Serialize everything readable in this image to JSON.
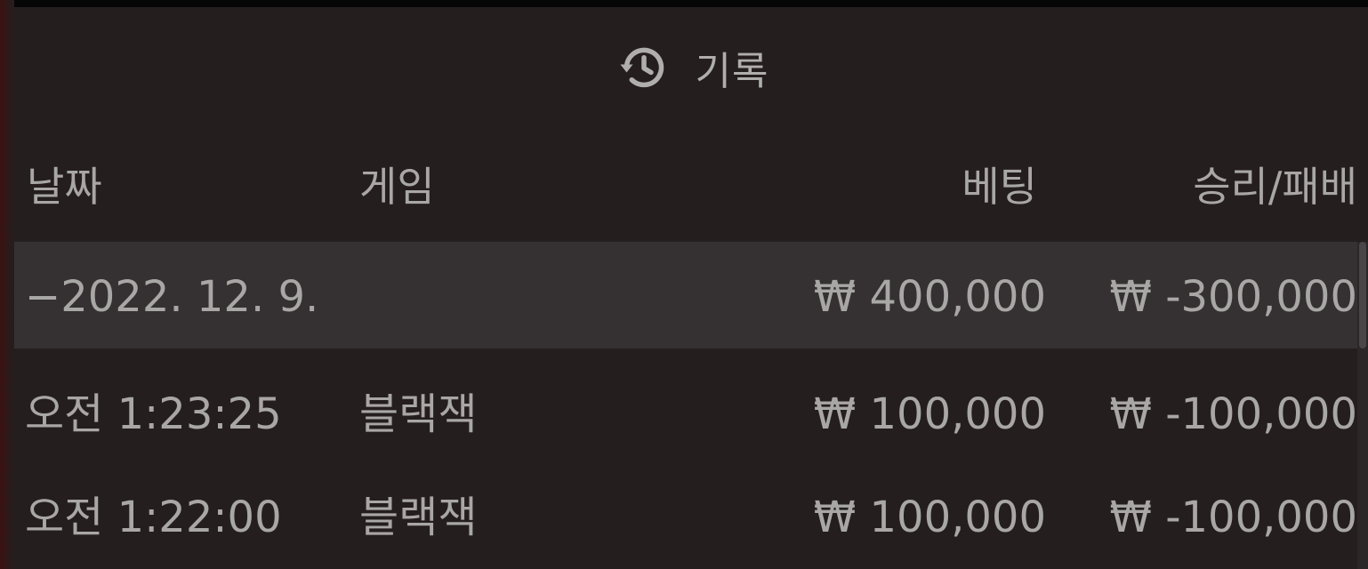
{
  "header": {
    "icon": "history-icon",
    "title": "기록"
  },
  "table": {
    "columns": {
      "date": "날짜",
      "game": "게임",
      "bet": "베팅",
      "win_loss": "승리/패배"
    },
    "group": {
      "date": "−2022. 12. 9.",
      "game": "",
      "bet": "₩ 400,000",
      "win_loss": "₩ -300,000"
    },
    "rows": [
      {
        "time": "오전 1:23:25",
        "game": "블랙잭",
        "bet": "₩ 100,000",
        "win_loss": "₩ -100,000"
      },
      {
        "time": "오전 1:22:00",
        "game": "블랙잭",
        "bet": "₩ 100,000",
        "win_loss": "₩ -100,000"
      }
    ]
  },
  "colors": {
    "background": "#241e1f",
    "group_row": "#353132",
    "text": "#a9a6a6"
  }
}
